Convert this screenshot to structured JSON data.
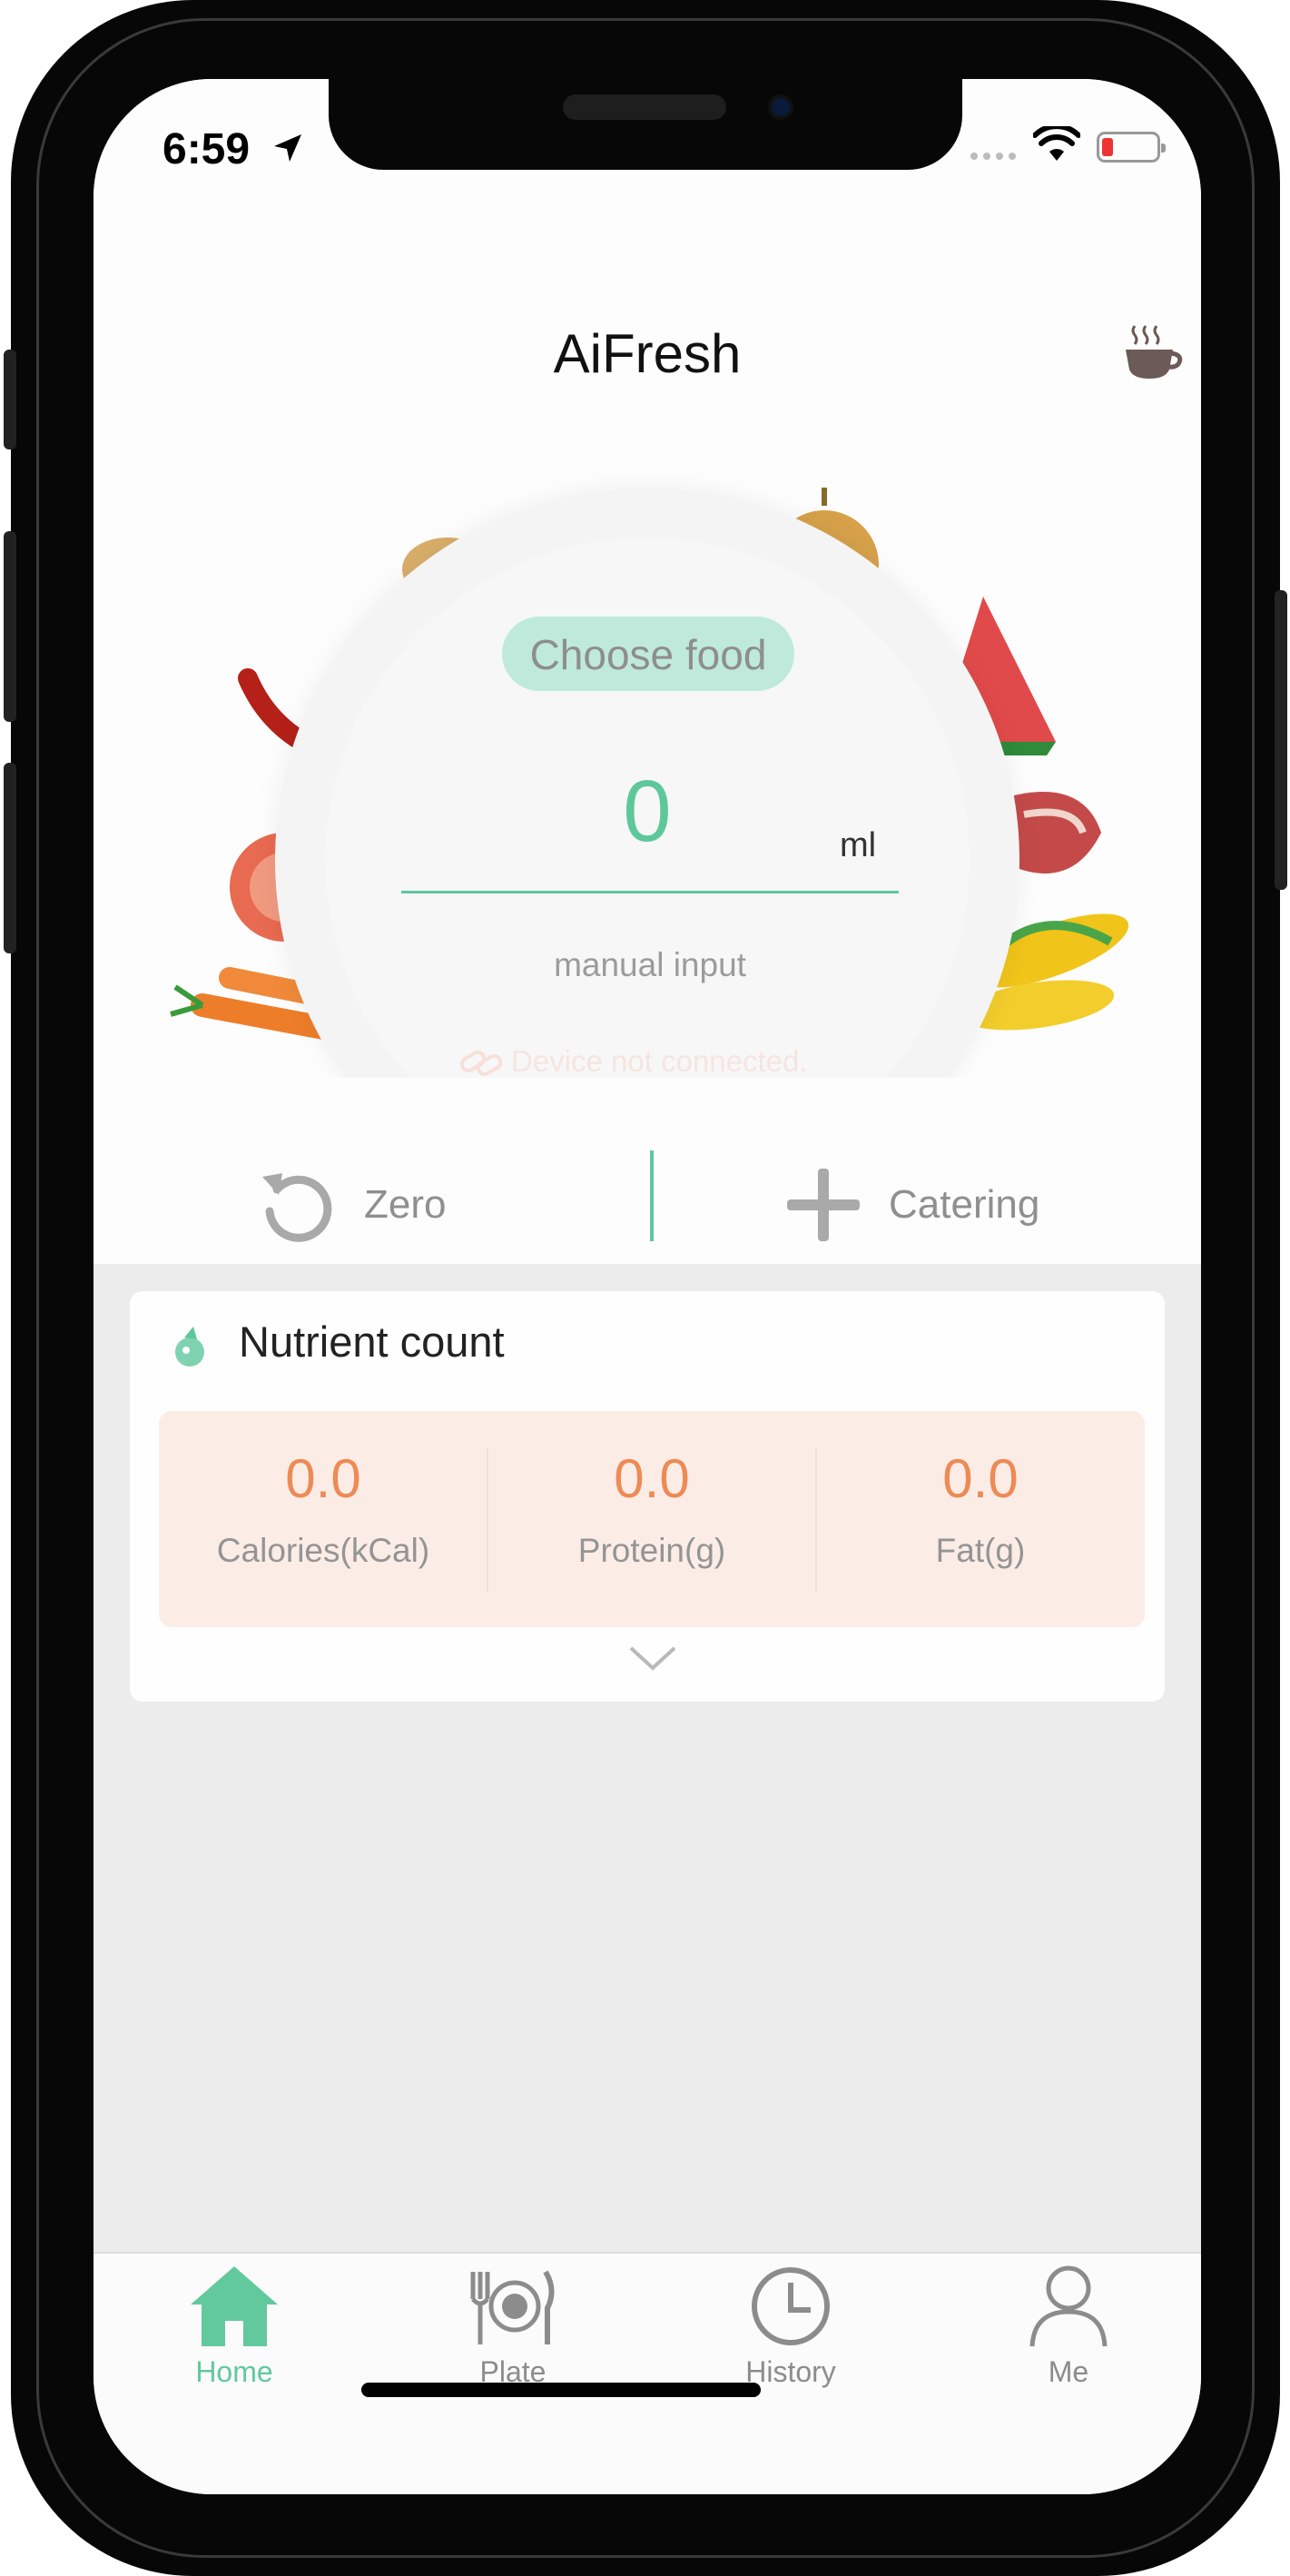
{
  "status_bar": {
    "time": "6:59"
  },
  "header": {
    "title": "AiFresh",
    "tea_icon": "tea-cup-icon"
  },
  "scale": {
    "choose_food_label": "Choose food",
    "weight_value": "0",
    "unit": "ml",
    "manual_input_label": "manual input",
    "device_status": "Device not connected."
  },
  "actions": {
    "zero_label": "Zero",
    "catering_label": "Catering"
  },
  "nutrients": {
    "title": "Nutrient count",
    "items": [
      {
        "value": "0.0",
        "label": "Calories(kCal)"
      },
      {
        "value": "0.0",
        "label": "Protein(g)"
      },
      {
        "value": "0.0",
        "label": "Fat(g)"
      }
    ]
  },
  "tabs": [
    {
      "label": "Home",
      "icon": "home-icon",
      "active": true
    },
    {
      "label": "Plate",
      "icon": "plate-icon",
      "active": false
    },
    {
      "label": "History",
      "icon": "clock-icon",
      "active": false
    },
    {
      "label": "Me",
      "icon": "person-icon",
      "active": false
    }
  ],
  "colors": {
    "accent": "#5ec89b",
    "nutrient_value": "#ee8a55",
    "nutrient_bg": "#fbede6"
  }
}
